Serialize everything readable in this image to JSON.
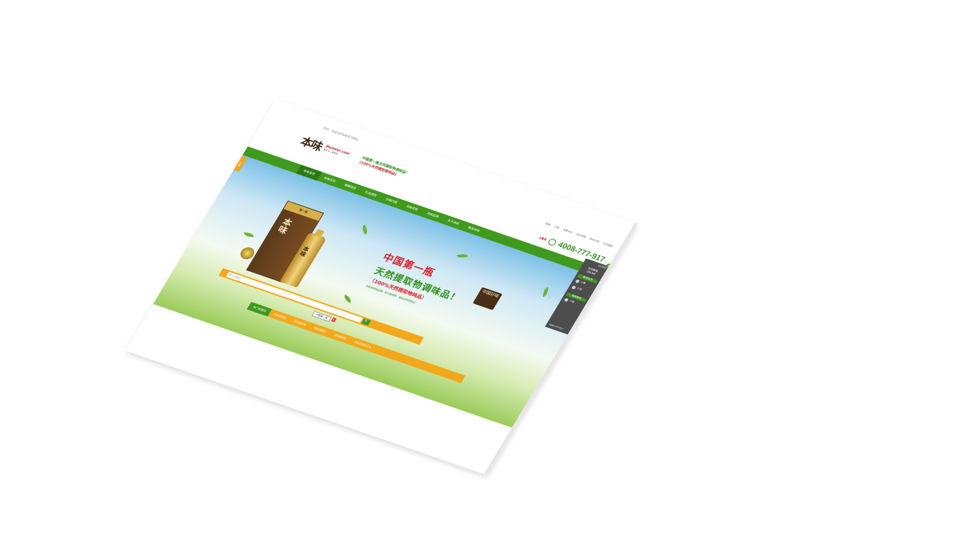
{
  "welcome": "您好！欢迎访问本味官方网站",
  "logo": {
    "name": "本味",
    "site": "ibenwei.com",
    "sub": "爱生活，爱本味"
  },
  "slogan": {
    "line1": "中国第一瓶天然提取物调味品！",
    "line2": "(100%天然提取物纯品)"
  },
  "toplinks": [
    "登录",
    "注册",
    "收藏本站",
    "网站地图",
    "联系本味",
    "在线客服"
  ],
  "hotline": "4008-777-917",
  "badge": "5周年",
  "nav": [
    "本味首页",
    "本味系列",
    "健康厨房",
    "礼品团购",
    "分销代理",
    "本味优势",
    "本味品牌",
    "关于本味",
    "联系本味"
  ],
  "side_tab": "分享",
  "banner": {
    "h1": "中国第一瓶",
    "h2": "天然提取物调味品！",
    "h3": "（100%天然提取物纯品）",
    "h4": "功能性调味品第一瓶多重营养，最安全的调味品",
    "stamp": "中国好味",
    "box_tag": "第一瓶",
    "box_title": "本味",
    "bottle_title": "本味"
  },
  "search": {
    "placeholder": "输入关键词",
    "button": "🔍"
  },
  "lang": {
    "selected": "中国第一瓶",
    "close": "x"
  },
  "categories": {
    "all": "热门关键词",
    "items": [
      "本味调味品",
      "调味品本味",
      "本味调味料",
      "天然调味料",
      "调味品原料本味"
    ]
  },
  "chat": {
    "close": "CLOSE",
    "header": "在线客服 ONLINE",
    "group1": "售前咨询",
    "group2": "售后服务",
    "agents": [
      "小李",
      "小刘",
      "小张"
    ],
    "tel": "4008-777-917"
  }
}
